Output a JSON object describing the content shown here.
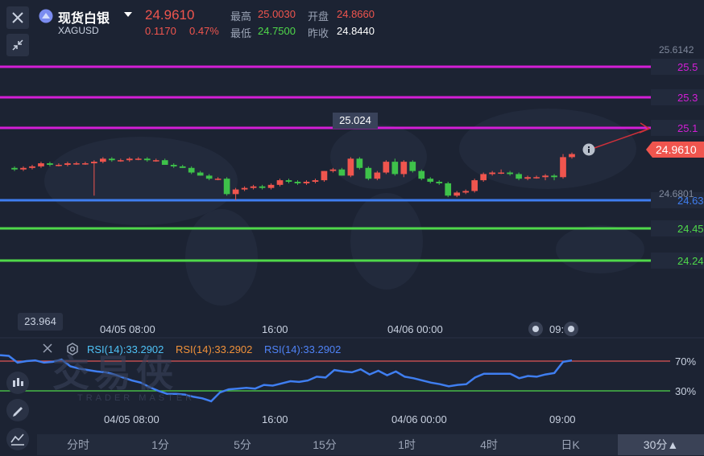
{
  "header": {
    "name": "现货白银",
    "symbol": "XAGUSD",
    "price": "24.9610",
    "change": "0.1170",
    "change_pct": "0.47%",
    "high_label": "最高",
    "high": "25.0030",
    "low_label": "最低",
    "low": "24.7500",
    "open_label": "开盘",
    "open": "24.8660",
    "prev_close_label": "昨收",
    "prev_close": "24.8440"
  },
  "chart_data": [
    {
      "type": "candlestick",
      "y_axis_top_label": "25.6142",
      "y_axis_bottom_label": "24.6801",
      "current_price_tag": "24.9610",
      "crosshair_label": "25.024",
      "low_marker_label": "23.964",
      "horizontal_lines": [
        {
          "label": "25.5",
          "color": "#d31ed6"
        },
        {
          "label": "25.3",
          "color": "#d31ed6"
        },
        {
          "label": "25.1",
          "color": "#d31ed6"
        },
        {
          "label": "24.63",
          "color": "#3f7ef0"
        },
        {
          "label": "24.45",
          "color": "#4fd84a"
        },
        {
          "label": "24.24",
          "color": "#4fd84a"
        }
      ],
      "x_ticks": [
        "04/05 08:00",
        "16:00",
        "04/06 00:00",
        "09:00"
      ],
      "candles": [
        {
          "o": 24.84,
          "h": 24.85,
          "l": 24.82,
          "c": 24.83
        },
        {
          "o": 24.83,
          "h": 24.85,
          "l": 24.82,
          "c": 24.84
        },
        {
          "o": 24.84,
          "h": 24.86,
          "l": 24.83,
          "c": 24.85
        },
        {
          "o": 24.85,
          "h": 24.88,
          "l": 24.84,
          "c": 24.87
        },
        {
          "o": 24.87,
          "h": 24.88,
          "l": 24.85,
          "c": 24.86
        },
        {
          "o": 24.86,
          "h": 24.87,
          "l": 24.85,
          "c": 24.86
        },
        {
          "o": 24.86,
          "h": 24.88,
          "l": 24.85,
          "c": 24.87
        },
        {
          "o": 24.87,
          "h": 24.88,
          "l": 24.86,
          "c": 24.87
        },
        {
          "o": 24.87,
          "h": 24.88,
          "l": 24.86,
          "c": 24.87
        },
        {
          "o": 24.87,
          "h": 24.89,
          "l": 24.66,
          "c": 24.88
        },
        {
          "o": 24.88,
          "h": 24.91,
          "l": 24.87,
          "c": 24.9
        },
        {
          "o": 24.9,
          "h": 24.91,
          "l": 24.88,
          "c": 24.89
        },
        {
          "o": 24.89,
          "h": 24.9,
          "l": 24.88,
          "c": 24.89
        },
        {
          "o": 24.89,
          "h": 24.91,
          "l": 24.88,
          "c": 24.9
        },
        {
          "o": 24.9,
          "h": 24.91,
          "l": 24.89,
          "c": 24.9
        },
        {
          "o": 24.9,
          "h": 24.91,
          "l": 24.88,
          "c": 24.89
        },
        {
          "o": 24.89,
          "h": 24.9,
          "l": 24.88,
          "c": 24.89
        },
        {
          "o": 24.89,
          "h": 24.9,
          "l": 24.86,
          "c": 24.86
        },
        {
          "o": 24.86,
          "h": 24.87,
          "l": 24.84,
          "c": 24.85
        },
        {
          "o": 24.85,
          "h": 24.86,
          "l": 24.84,
          "c": 24.84
        },
        {
          "o": 24.84,
          "h": 24.85,
          "l": 24.8,
          "c": 24.81
        },
        {
          "o": 24.81,
          "h": 24.82,
          "l": 24.79,
          "c": 24.79
        },
        {
          "o": 24.79,
          "h": 24.8,
          "l": 24.76,
          "c": 24.77
        },
        {
          "o": 24.77,
          "h": 24.78,
          "l": 24.76,
          "c": 24.77
        },
        {
          "o": 24.77,
          "h": 24.78,
          "l": 24.66,
          "c": 24.67
        },
        {
          "o": 24.67,
          "h": 24.71,
          "l": 24.63,
          "c": 24.7
        },
        {
          "o": 24.7,
          "h": 24.72,
          "l": 24.69,
          "c": 24.71
        },
        {
          "o": 24.71,
          "h": 24.73,
          "l": 24.7,
          "c": 24.72
        },
        {
          "o": 24.72,
          "h": 24.73,
          "l": 24.7,
          "c": 24.71
        },
        {
          "o": 24.71,
          "h": 24.74,
          "l": 24.7,
          "c": 24.73
        },
        {
          "o": 24.73,
          "h": 24.77,
          "l": 24.72,
          "c": 24.76
        },
        {
          "o": 24.76,
          "h": 24.77,
          "l": 24.74,
          "c": 24.75
        },
        {
          "o": 24.75,
          "h": 24.76,
          "l": 24.73,
          "c": 24.74
        },
        {
          "o": 24.74,
          "h": 24.76,
          "l": 24.73,
          "c": 24.75
        },
        {
          "o": 24.75,
          "h": 24.77,
          "l": 24.74,
          "c": 24.76
        },
        {
          "o": 24.76,
          "h": 24.82,
          "l": 24.75,
          "c": 24.82
        },
        {
          "o": 24.82,
          "h": 24.84,
          "l": 24.81,
          "c": 24.83
        },
        {
          "o": 24.83,
          "h": 24.84,
          "l": 24.79,
          "c": 24.79
        },
        {
          "o": 24.79,
          "h": 24.91,
          "l": 24.78,
          "c": 24.9
        },
        {
          "o": 24.9,
          "h": 24.91,
          "l": 24.83,
          "c": 24.84
        },
        {
          "o": 24.84,
          "h": 24.85,
          "l": 24.76,
          "c": 24.77
        },
        {
          "o": 24.77,
          "h": 24.82,
          "l": 24.76,
          "c": 24.81
        },
        {
          "o": 24.81,
          "h": 24.89,
          "l": 24.8,
          "c": 24.88
        },
        {
          "o": 24.88,
          "h": 24.9,
          "l": 24.79,
          "c": 24.8
        },
        {
          "o": 24.8,
          "h": 24.89,
          "l": 24.78,
          "c": 24.88
        },
        {
          "o": 24.88,
          "h": 24.89,
          "l": 24.81,
          "c": 24.82
        },
        {
          "o": 24.82,
          "h": 24.83,
          "l": 24.76,
          "c": 24.77
        },
        {
          "o": 24.77,
          "h": 24.78,
          "l": 24.74,
          "c": 24.75
        },
        {
          "o": 24.75,
          "h": 24.76,
          "l": 24.73,
          "c": 24.74
        },
        {
          "o": 24.74,
          "h": 24.75,
          "l": 24.65,
          "c": 24.66
        },
        {
          "o": 24.66,
          "h": 24.69,
          "l": 24.65,
          "c": 24.68
        },
        {
          "o": 24.68,
          "h": 24.7,
          "l": 24.67,
          "c": 24.69
        },
        {
          "o": 24.69,
          "h": 24.77,
          "l": 24.68,
          "c": 24.76
        },
        {
          "o": 24.76,
          "h": 24.81,
          "l": 24.75,
          "c": 24.8
        },
        {
          "o": 24.8,
          "h": 24.82,
          "l": 24.79,
          "c": 24.81
        },
        {
          "o": 24.81,
          "h": 24.83,
          "l": 24.8,
          "c": 24.81
        },
        {
          "o": 24.81,
          "h": 24.82,
          "l": 24.79,
          "c": 24.8
        },
        {
          "o": 24.8,
          "h": 24.81,
          "l": 24.76,
          "c": 24.77
        },
        {
          "o": 24.77,
          "h": 24.79,
          "l": 24.76,
          "c": 24.78
        },
        {
          "o": 24.78,
          "h": 24.79,
          "l": 24.77,
          "c": 24.78
        },
        {
          "o": 24.78,
          "h": 24.8,
          "l": 24.76,
          "c": 24.79
        },
        {
          "o": 24.79,
          "h": 24.8,
          "l": 24.76,
          "c": 24.78
        },
        {
          "o": 24.78,
          "h": 24.93,
          "l": 24.77,
          "c": 24.91
        },
        {
          "o": 24.91,
          "h": 24.94,
          "l": 24.9,
          "c": 24.93
        }
      ]
    },
    {
      "type": "line",
      "name": "RSI(14)",
      "legend": [
        {
          "text": "RSI(14):33.2902",
          "color": "#4fc3f7"
        },
        {
          "text": "RSI(14):33.2902",
          "color": "#f0913a"
        },
        {
          "text": "RSI(14):33.2902",
          "color": "#4f83f7"
        }
      ],
      "levels": [
        {
          "label": "70%",
          "value": 70,
          "color": "#e05555"
        },
        {
          "label": "30%",
          "value": 30,
          "color": "#4fd84a"
        }
      ],
      "ylim": [
        10,
        90
      ],
      "x_ticks": [
        "04/05 08:00",
        "16:00",
        "04/06 00:00",
        "09:00"
      ],
      "values": [
        78,
        77,
        68,
        70,
        71,
        68,
        69,
        72,
        63,
        60,
        58,
        56,
        55,
        52,
        48,
        44,
        41,
        35,
        30,
        26,
        26,
        25,
        22,
        20,
        16,
        28,
        32,
        33,
        34,
        33,
        38,
        37,
        40,
        43,
        42,
        44,
        49,
        48,
        58,
        56,
        55,
        59,
        52,
        57,
        51,
        56,
        49,
        47,
        44,
        41,
        39,
        36,
        38,
        39,
        48,
        53,
        53,
        53,
        53,
        47,
        50,
        49,
        52,
        54,
        69,
        71
      ]
    }
  ],
  "price_watermark": {
    "brand": "交易侠",
    "sub": "TRADER MASTER"
  },
  "timeframes": [
    "分时",
    "1分",
    "5分",
    "15分",
    "1时",
    "4时",
    "日K",
    "30分▲"
  ]
}
